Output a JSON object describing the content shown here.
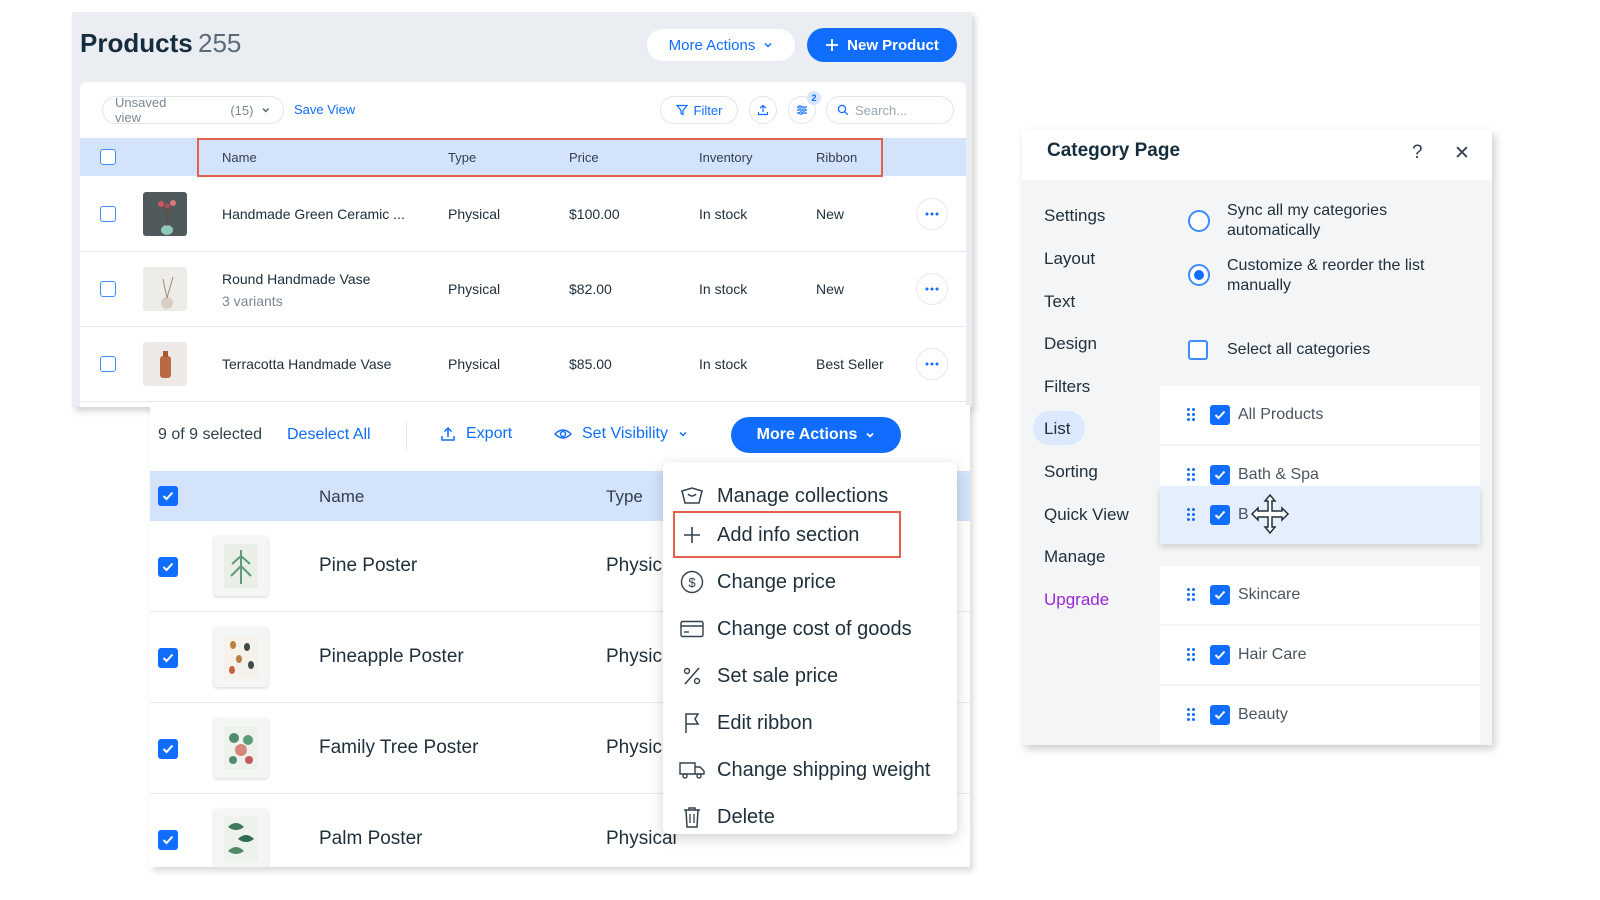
{
  "products_panel": {
    "title": "Products",
    "count": "255",
    "more_actions_label": "More Actions",
    "new_product_label": "New Product",
    "view_select": {
      "label": "Unsaved view",
      "count": "(15)"
    },
    "save_view_label": "Save View",
    "filter_label": "Filter",
    "filter_badge": "2",
    "search_placeholder": "Search...",
    "columns": [
      "Name",
      "Type",
      "Price",
      "Inventory",
      "Ribbon"
    ],
    "rows": [
      {
        "name": "Handmade Green Ceramic ...",
        "variants": "",
        "type": "Physical",
        "price": "$100.00",
        "inventory": "In stock",
        "ribbon": "New"
      },
      {
        "name": "Round Handmade Vase",
        "variants": "3 variants",
        "type": "Physical",
        "price": "$82.00",
        "inventory": "In stock",
        "ribbon": "New"
      },
      {
        "name": "Terracotta Handmade Vase",
        "variants": "",
        "type": "Physical",
        "price": "$85.00",
        "inventory": "In stock",
        "ribbon": "Best Seller"
      }
    ]
  },
  "bulk_panel": {
    "selected_text": "9 of 9 selected",
    "deselect_label": "Deselect All",
    "export_label": "Export",
    "set_visibility_label": "Set Visibility",
    "more_actions_label": "More Actions",
    "columns": {
      "name": "Name",
      "type": "Type"
    },
    "rows": [
      {
        "name": "Pine Poster",
        "type": "Physic"
      },
      {
        "name": "Pineapple Poster",
        "type": "Physic"
      },
      {
        "name": "Family Tree Poster",
        "type": "Physic"
      },
      {
        "name": "Palm Poster",
        "type": "Physical"
      }
    ],
    "menu_items": [
      {
        "label": "Manage collections",
        "icon": "collections-icon"
      },
      {
        "label": "Add info section",
        "icon": "plus-icon"
      },
      {
        "label": "Change price",
        "icon": "dollar-circle-icon"
      },
      {
        "label": "Change cost of goods",
        "icon": "credit-card-icon"
      },
      {
        "label": "Set sale price",
        "icon": "percent-icon"
      },
      {
        "label": "Edit ribbon",
        "icon": "flag-icon"
      },
      {
        "label": "Change shipping weight",
        "icon": "truck-icon"
      },
      {
        "label": "Delete",
        "icon": "trash-icon"
      }
    ]
  },
  "category_panel": {
    "title": "Category Page",
    "help_icon": "?",
    "close_icon": "✕",
    "nav": [
      "Settings",
      "Layout",
      "Text",
      "Design",
      "Filters",
      "List",
      "Sorting",
      "Quick View",
      "Manage",
      "Upgrade"
    ],
    "active_nav": "List",
    "options": {
      "sync": "Sync all my categories automatically",
      "customize": "Customize & reorder the list manually",
      "select_all": "Select all categories"
    },
    "categories": [
      "All Products",
      "Bath & Spa",
      "B",
      "Skincare",
      "Hair Care",
      "Beauty"
    ]
  },
  "colors": {
    "accent": "#116dff",
    "header_bg": "#d3e3fb",
    "highlight": "#e3604c",
    "upgrade": "#9a27d5"
  }
}
